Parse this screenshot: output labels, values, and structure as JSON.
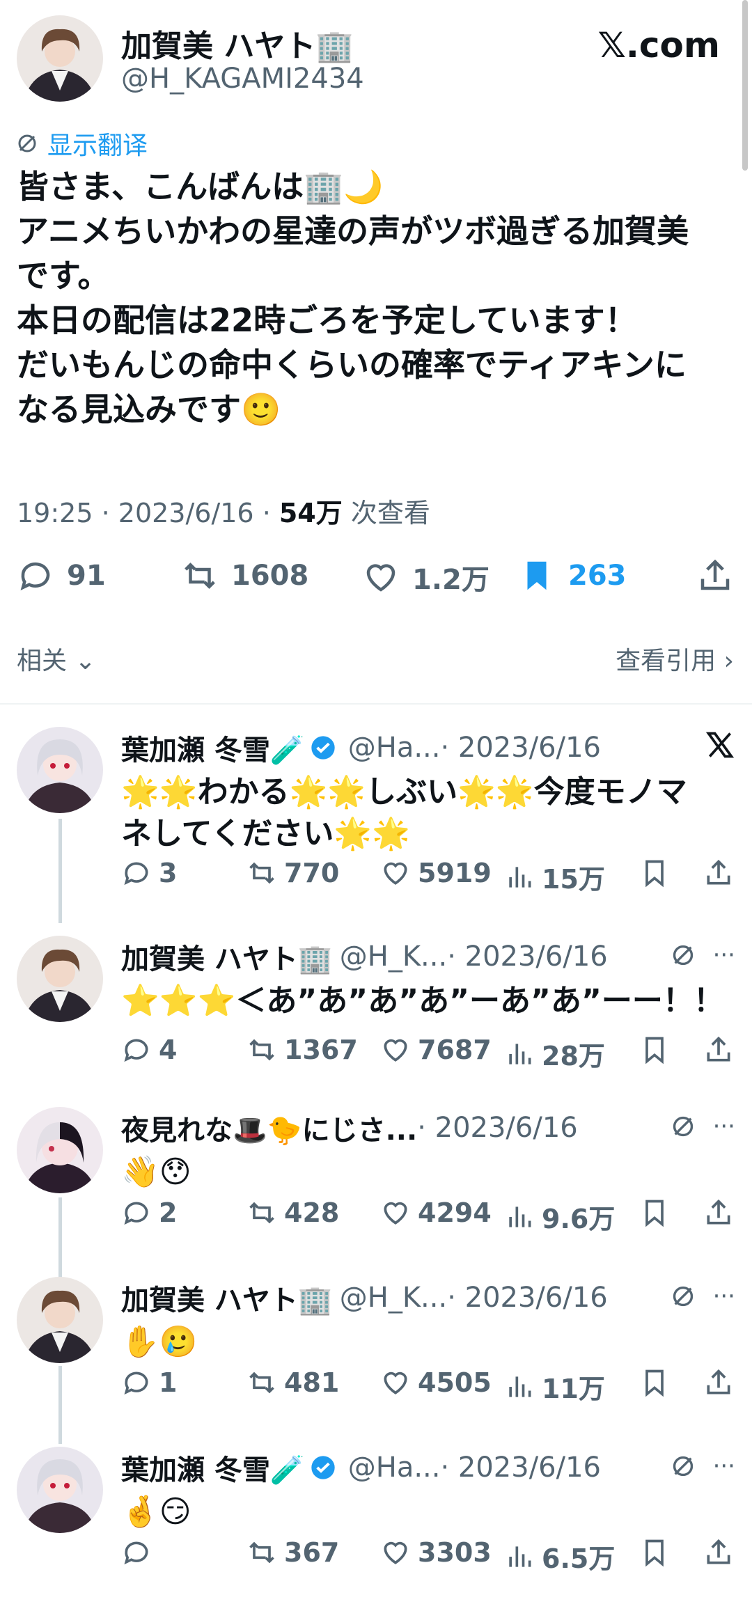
{
  "main": {
    "display_name": "加賀美 ハヤト🏢",
    "handle": "@H_KAGAMI2434",
    "brand": "𝕏.com",
    "translate_label": "显示翻译",
    "text_lines": [
      "皆さま、こんばんは🏢🌙",
      "アニメちいかわの星達の声がツボ過ぎる加賀美",
      "です。",
      "本日の配信は22時ごろを予定しています！",
      "だいもんじの命中くらいの確率でティアキンに",
      "なる見込みです🙂"
    ],
    "time": "19:25",
    "date": "2023/6/16",
    "views_count": "54万",
    "views_label": "次查看",
    "replies": "91",
    "retweets": "1608",
    "likes": "1.2万",
    "bookmarks": "263",
    "related_label": "相关",
    "quotes_label": "查看引用"
  },
  "replies": [
    {
      "display_name": "葉加瀬 冬雪🧪",
      "verified": true,
      "handle": "@Ha...",
      "date": "· 2023/6/16",
      "corner": "x-logo",
      "text_lines": [
        "🌟🌟わかる🌟🌟しぶい🌟🌟今度モノマ",
        "ネしてください🌟🌟"
      ],
      "replies": "3",
      "retweets": "770",
      "likes": "5919",
      "views": "15万"
    },
    {
      "display_name": "加賀美 ハヤト🏢",
      "verified": false,
      "handle": "@H_K...",
      "date": "· 2023/6/16",
      "corner": "translate-more",
      "text_lines": [
        "⭐⭐⭐＜あ”あ”あ”あ”ーあ”あ”ーー！！"
      ],
      "replies": "4",
      "retweets": "1367",
      "likes": "7687",
      "views": "28万"
    },
    {
      "display_name": "夜見れな🎩🐤にじさ...",
      "verified": false,
      "handle": "",
      "date": "· 2023/6/16",
      "corner": "translate-more",
      "text_lines": [
        "👋😯"
      ],
      "replies": "2",
      "retweets": "428",
      "likes": "4294",
      "views": "9.6万"
    },
    {
      "display_name": "加賀美 ハヤト🏢",
      "verified": false,
      "handle": "@H_K...",
      "date": "· 2023/6/16",
      "corner": "translate-more",
      "text_lines": [
        "✋🥲"
      ],
      "replies": "1",
      "retweets": "481",
      "likes": "4505",
      "views": "11万"
    },
    {
      "display_name": "葉加瀬 冬雪🧪",
      "verified": true,
      "handle": "@Ha...",
      "date": "· 2023/6/16",
      "corner": "translate-more",
      "text_lines": [
        "🤞😏"
      ],
      "replies": "",
      "retweets": "367",
      "likes": "3303",
      "views": "6.5万"
    }
  ],
  "colors": {
    "accent": "#1d9bf0",
    "muted": "#536471",
    "text": "#0f1419"
  }
}
